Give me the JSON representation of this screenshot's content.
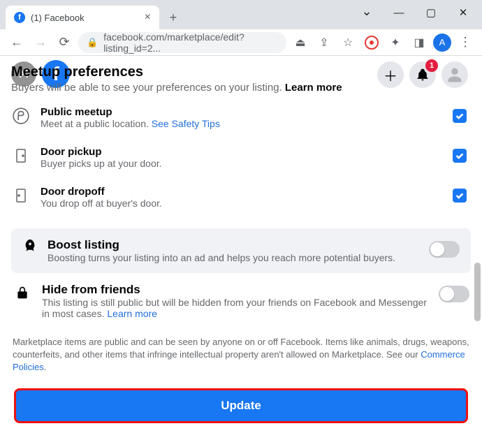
{
  "tab": {
    "title": "(1) Facebook"
  },
  "url": "facebook.com/marketplace/edit?listing_id=2...",
  "avatar_letter": "A",
  "section": {
    "title": "Meetup preferences",
    "subtitle": "Buyers will be able to see your preferences on your listing. ",
    "learn_more": "Learn more"
  },
  "prefs": [
    {
      "title": "Public meetup",
      "sub": "Meet at a public location. ",
      "link": "See Safety Tips",
      "checked": true
    },
    {
      "title": "Door pickup",
      "sub": "Buyer picks up at your door.",
      "checked": true
    },
    {
      "title": "Door dropoff",
      "sub": "You drop off at buyer's door.",
      "checked": true
    }
  ],
  "boost": {
    "title": "Boost listing",
    "sub": "Boosting turns your listing into an ad and helps you reach more potential buyers."
  },
  "hide": {
    "title": "Hide from friends",
    "sub": "This listing is still public but will be hidden from your friends on Facebook and Messenger in most cases. ",
    "learn_more": "Learn more"
  },
  "footer": {
    "text": "Marketplace items are public and can be seen by anyone on or off Facebook. Items like animals, drugs, weapons, counterfeits, and other items that infringe intellectual property aren't allowed on Marketplace. See our ",
    "link": "Commerce Policies"
  },
  "update_label": "Update",
  "notif_count": "1"
}
